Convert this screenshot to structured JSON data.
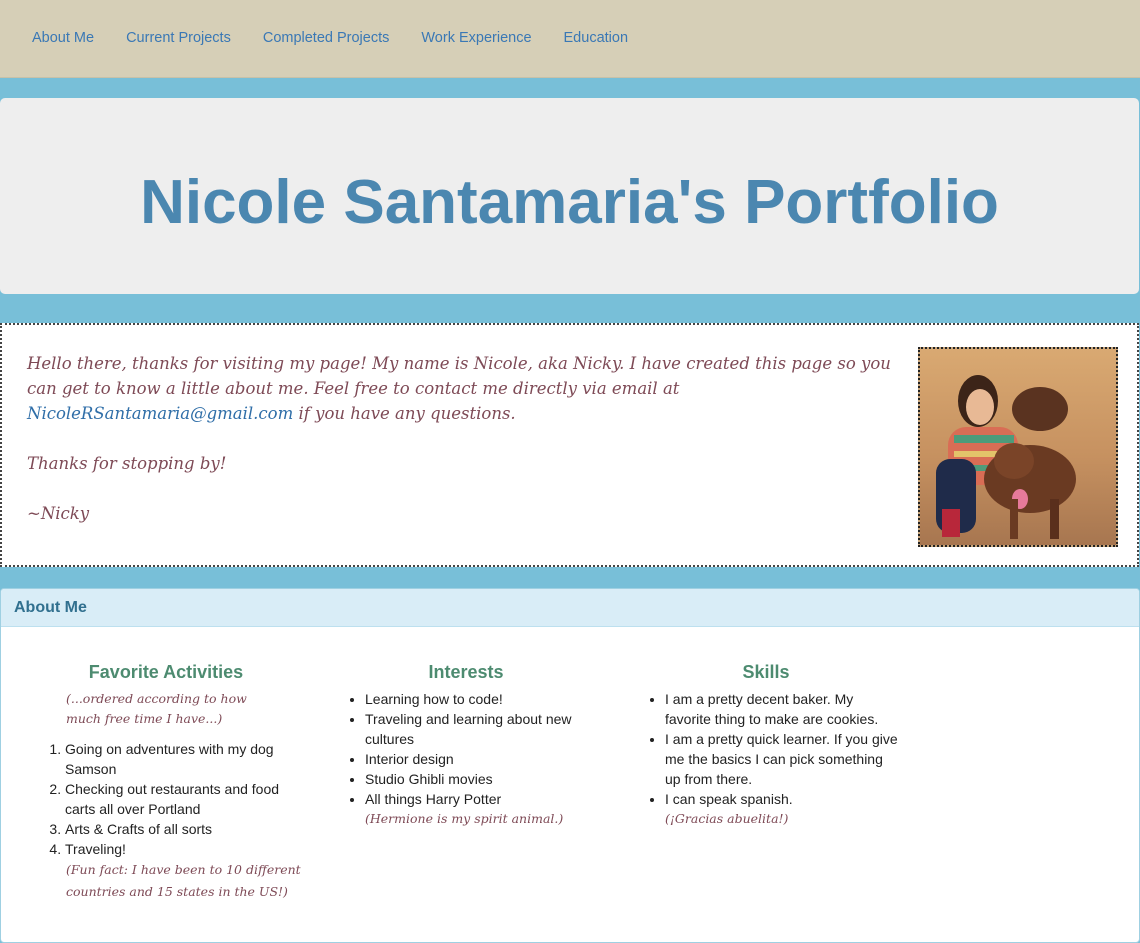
{
  "nav": {
    "items": [
      {
        "label": "About Me"
      },
      {
        "label": "Current Projects"
      },
      {
        "label": "Completed Projects"
      },
      {
        "label": "Work Experience"
      },
      {
        "label": "Education"
      }
    ]
  },
  "header": {
    "title": "Nicole Santamaria's Portfolio"
  },
  "intro": {
    "paragraph_start": "Hello there, thanks for visiting my page! My name is Nicole, aka Nicky. I have created this page so you can get to know a little about me. Feel free to contact me directly via email at ",
    "email": "NicoleRSantamaria@gmail.com",
    "paragraph_end": " if you have any questions.",
    "thanks": "Thanks for stopping by!",
    "signature": "~Nicky"
  },
  "about": {
    "heading": "About Me",
    "activities": {
      "title": "Favorite Activities",
      "note": "(...ordered according to how much free time I have...)",
      "items": [
        "Going on adventures with my dog Samson",
        "Checking out restaurants and food carts all over Portland",
        "Arts & Crafts of all sorts",
        "Traveling!"
      ],
      "after_note": "(Fun fact: I have been to 10 different countries and 15 states in the US!)"
    },
    "interests": {
      "title": "Interests",
      "items": [
        "Learning how to code!",
        "Traveling and learning about new cultures",
        "Interior design",
        "Studio Ghibli movies",
        "All things Harry Potter"
      ],
      "after_note": "(Hermione is my spirit animal.)"
    },
    "skills": {
      "title": "Skills",
      "items": [
        "I am a pretty decent baker. My favorite thing to make are cookies.",
        "I am a pretty quick learner. If you give me the basics I can pick something up from there.",
        "I can speak spanish."
      ],
      "after_note": "(¡Gracias abuelita!)"
    }
  }
}
